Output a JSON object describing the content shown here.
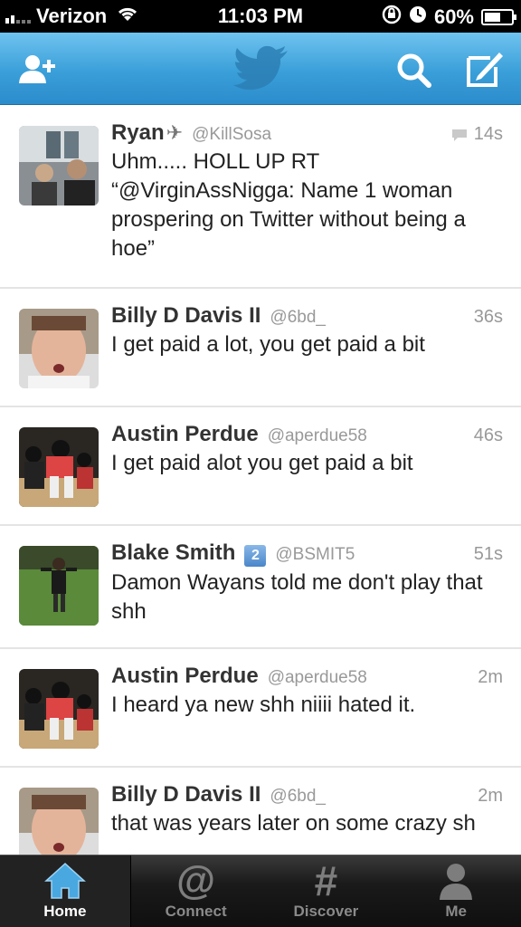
{
  "status": {
    "carrier": "Verizon",
    "time": "11:03 PM",
    "battery": "60%",
    "battery_level": 0.6
  },
  "nav": {
    "title_icon": "twitter-bird-icon"
  },
  "tweets": [
    {
      "name": "Ryan",
      "handle": "@KillSosa",
      "time": "14s",
      "text": "Uhm..... HOLL UP  RT “@VirginAssNigga: Name 1 woman prospering on Twitter without being a hoe”",
      "has_reply_icon": true,
      "has_plane": true
    },
    {
      "name": "Billy D Davis II",
      "handle": "@6bd_",
      "time": "36s",
      "text": "I get paid a lot, you get paid a bit"
    },
    {
      "name": "Austin Perdue",
      "handle": "@aperdue58",
      "time": "46s",
      "text": "I get paid alot you get paid a bit"
    },
    {
      "name": "Blake Smith",
      "badge": "2",
      "handle": "@BSMIT5",
      "time": "51s",
      "text": "Damon Wayans told me don't play that shh"
    },
    {
      "name": "Austin Perdue",
      "handle": "@aperdue58",
      "time": "2m",
      "text": "I heard ya new shh niiii hated it."
    },
    {
      "name": "Billy D Davis II",
      "handle": "@6bd_",
      "time": "2m",
      "text": "that was years later on some crazy sh"
    }
  ],
  "tabs": [
    {
      "label": "Home",
      "icon": "home-icon"
    },
    {
      "label": "Connect",
      "icon": "at-icon"
    },
    {
      "label": "Discover",
      "icon": "hash-icon"
    },
    {
      "label": "Me",
      "icon": "person-icon"
    }
  ],
  "colors": {
    "nav_blue": "#3a9fd9",
    "tab_active": "#ffffff",
    "tab_inactive": "#8a8a8a"
  }
}
